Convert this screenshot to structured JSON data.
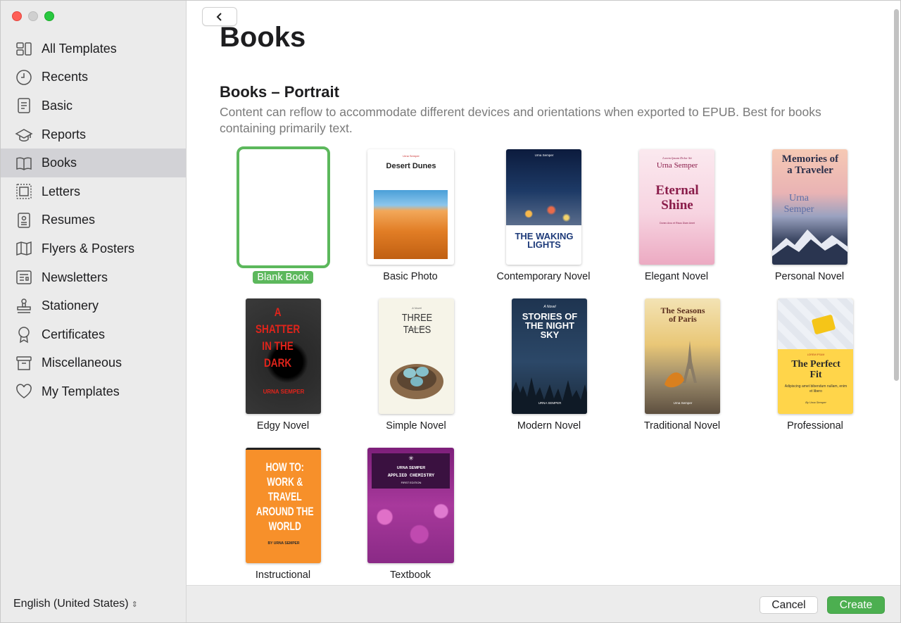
{
  "sidebar": {
    "items": [
      {
        "label": "All Templates",
        "icon": "grid-icon"
      },
      {
        "label": "Recents",
        "icon": "clock-icon"
      },
      {
        "label": "Basic",
        "icon": "document-icon"
      },
      {
        "label": "Reports",
        "icon": "graduation-cap-icon"
      },
      {
        "label": "Books",
        "icon": "book-icon"
      },
      {
        "label": "Letters",
        "icon": "stamp-letter-icon"
      },
      {
        "label": "Resumes",
        "icon": "resume-icon"
      },
      {
        "label": "Flyers & Posters",
        "icon": "map-icon"
      },
      {
        "label": "Newsletters",
        "icon": "newsletter-icon"
      },
      {
        "label": "Stationery",
        "icon": "rubber-stamp-icon"
      },
      {
        "label": "Certificates",
        "icon": "ribbon-icon"
      },
      {
        "label": "Miscellaneous",
        "icon": "archive-box-icon"
      },
      {
        "label": "My Templates",
        "icon": "heart-icon"
      }
    ],
    "active_index": 4,
    "language": "English (United States)"
  },
  "main": {
    "page_title": "Books",
    "section_title": "Books – Portrait",
    "section_desc": "Content can reflow to accommodate different devices and orientations when exported to EPUB. Best for books containing primarily text.",
    "templates": [
      {
        "label": "Blank Book",
        "selected": true
      },
      {
        "label": "Basic Photo",
        "cover_title": "Desert Dunes",
        "cover_author": "Urna Semper"
      },
      {
        "label": "Contemporary Novel",
        "cover_title": "THE WAKING LIGHTS",
        "cover_author": "Urna Semper"
      },
      {
        "label": "Elegant Novel",
        "cover_kicker": "Lorem Ipsum Dolor Sit",
        "cover_author": "Urna Semper",
        "cover_title": "Eternal Shine",
        "cover_sub": "Donec Arcu et Risus Diam Amet"
      },
      {
        "label": "Personal Novel",
        "cover_title": "Memories of a Traveler",
        "cover_author": "Urna Semper"
      },
      {
        "label": "Edgy Novel",
        "cover_title": "A SHATTER IN THE DARK",
        "cover_author": "URNA SEMPER"
      },
      {
        "label": "Simple Novel",
        "cover_kicker": "A Novel",
        "cover_title": "THREE TALES",
        "cover_author": "URNA SEMPER"
      },
      {
        "label": "Modern Novel",
        "cover_kicker": "A Novel",
        "cover_title": "STORIES OF THE NIGHT SKY",
        "cover_author": "URNA SEMPER"
      },
      {
        "label": "Traditional Novel",
        "cover_title": "The Seasons of Paris",
        "cover_author": "Urna Semper"
      },
      {
        "label": "Professional",
        "cover_kicker": "LOREM IPSUM",
        "cover_title": "The Perfect Fit",
        "cover_sub": "Adipiscing amet bibendum nullam, enim et libero",
        "cover_author": "By Urna Semper"
      },
      {
        "label": "Instructional",
        "cover_title": "HOW TO: WORK & TRAVEL AROUND THE WORLD",
        "cover_author": "BY URNA SEMPER"
      },
      {
        "label": "Textbook",
        "cover_author": "URNA SEMPER",
        "cover_title": "APPLIED CHEMISTRY",
        "cover_sub": "FIRST EDITION"
      }
    ]
  },
  "footer": {
    "cancel_label": "Cancel",
    "create_label": "Create"
  },
  "colors": {
    "accent_green": "#5cb85c",
    "create_button": "#4caf50",
    "sidebar_bg": "#ebebeb",
    "sidebar_active": "#d2d2d6"
  }
}
